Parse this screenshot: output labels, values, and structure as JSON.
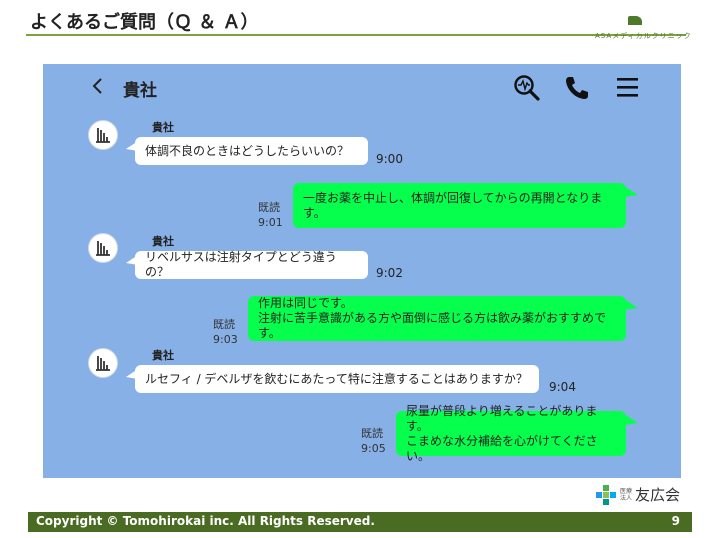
{
  "slide": {
    "title": "よくあるご質問（Ｑ ＆ Ａ）",
    "brand_text": "ASAメディカルクリニック",
    "org_kind_1": "医療",
    "org_kind_2": "法人",
    "org_name": "友広会",
    "copyright": "Copyright © Tomohirokai inc. All Rights Reserved.",
    "page_number": "9"
  },
  "chat": {
    "back_icon": "chevron-left-icon",
    "title": "貴社",
    "icons": [
      "search-icon",
      "phone-icon",
      "menu-icon"
    ],
    "colors": {
      "background": "#87b0e6",
      "incoming": "#ffffff",
      "outgoing": "#06ff4d"
    },
    "messages": [
      {
        "sender": "貴社",
        "text": "体調不良のときはどうしたらいいの？",
        "time": "9:00"
      },
      {
        "read_label": "既読",
        "time": "9:01",
        "text": "一度お薬を中止し、体調が回復してからの再開となります。"
      },
      {
        "sender": "貴社",
        "text": "リベルサスは注射タイプとどう違うの？",
        "time": "9:02"
      },
      {
        "read_label": "既読",
        "time": "9:03",
        "line1": "作用は同じです。",
        "line2": "注射に苦手意識がある方や面倒に感じる方は飲み薬がおすすめです。"
      },
      {
        "sender": "貴社",
        "text": "ルセフィ / デベルザを飲むにあたって特に注意することはありますか？",
        "time": "9:04"
      },
      {
        "read_label": "既読",
        "time": "9:05",
        "line1": "尿量が普段より増えることがあります。",
        "line2": "こまめな水分補給を心がけてください。"
      }
    ]
  }
}
